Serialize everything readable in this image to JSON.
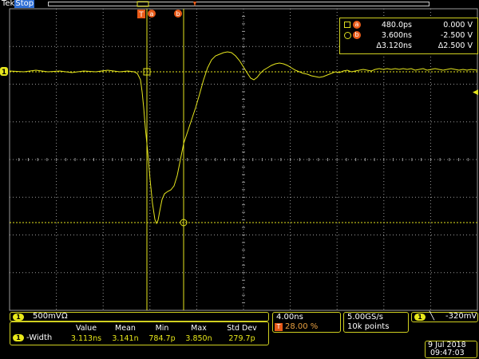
{
  "status": {
    "brand": "Tek",
    "state": "Stop"
  },
  "markers": {
    "trigger_label": "T",
    "cursor_a_label": "a",
    "cursor_b_label": "b",
    "ch1_label": "1",
    "trig_level_arrow": "◀"
  },
  "cursor_readout": {
    "row_a": {
      "time": "480.0ps",
      "volt": "0.000 V"
    },
    "row_b": {
      "time": "3.600ns",
      "volt": "-2.500 V"
    },
    "row_delta": {
      "time": "Δ3.120ns",
      "volt": "Δ2.500 V"
    }
  },
  "channel": {
    "number": "1",
    "scale": "500mV",
    "coupling_symbol": "Ω"
  },
  "measurement": {
    "name": "-Width",
    "headers": [
      "Value",
      "Mean",
      "Min",
      "Max",
      "Std Dev"
    ],
    "values": [
      "3.113ns",
      "3.141n",
      "784.7p",
      "3.850n",
      "279.7p"
    ]
  },
  "horizontal": {
    "scale": "4.00ns",
    "trigger_position": "28.00 %"
  },
  "acquisition": {
    "sample_rate": "5.00GS/s",
    "record_length": "10k points"
  },
  "trigger": {
    "channel": "1",
    "slope_symbol": "╲",
    "level": "-320mV"
  },
  "datetime": {
    "date": "9 Jul  2018",
    "time": "09:47:03"
  },
  "colors": {
    "trace": "#e6e61e",
    "grid": "#9a9a9a",
    "border": "#cfcf20",
    "orange": "#e85a18",
    "status_blue": "#2f6fd6"
  }
}
